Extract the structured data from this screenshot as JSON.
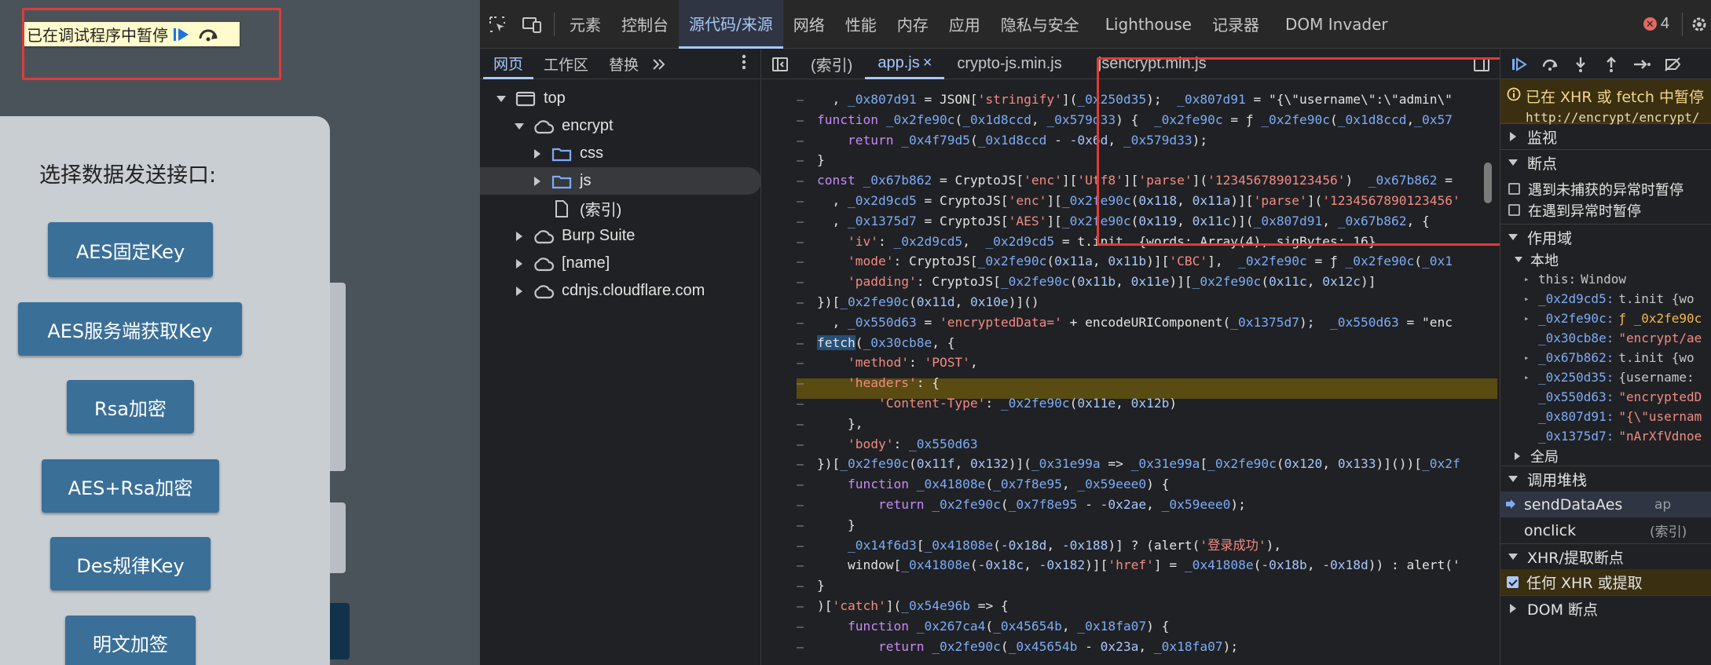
{
  "page": {
    "paused_banner": "已在调试程序中暂停",
    "card_title": "选择数据发送接口:",
    "buttons": [
      "AES固定Key",
      "AES服务端获取Key",
      "Rsa加密",
      "AES+Rsa加密",
      "Des规律Key",
      "明文加签"
    ]
  },
  "devtools": {
    "tabs": [
      "元素",
      "控制台",
      "源代码/来源",
      "网络",
      "性能",
      "内存",
      "应用",
      "隐私与安全",
      "Lighthouse",
      "记录器",
      "DOM Invader"
    ],
    "active_tab": "源代码/来源",
    "error_count": "4",
    "navigator_tabs": [
      "网页",
      "工作区",
      "替换"
    ],
    "tree": [
      {
        "label": "top",
        "icon": "window-icon",
        "arrow": "down"
      },
      {
        "label": "encrypt",
        "icon": "cloud-icon",
        "arrow": "down"
      },
      {
        "label": "css",
        "icon": "folder-icon",
        "arrow": "right"
      },
      {
        "label": "js",
        "icon": "folder-icon",
        "arrow": "right"
      },
      {
        "label": "(索引)",
        "icon": "file-icon",
        "arrow": ""
      },
      {
        "label": "Burp Suite",
        "icon": "cloud-icon",
        "arrow": "right"
      },
      {
        "label": "[name]",
        "icon": "cloud-icon",
        "arrow": "right"
      },
      {
        "label": "cdnjs.cloudflare.com",
        "icon": "cloud-icon",
        "arrow": "right"
      }
    ],
    "editor_tabs": [
      "(索引)",
      "app.js",
      "crypto-js.min.js",
      "jsencrypt.min.js"
    ],
    "active_editor_tab": "app.js",
    "code_lines": [
      "  , _0x807d91 = JSON['stringify'](_0x250d35);  _0x807d91 = \"{\\\"username\\\":\\\"admin\\\"",
      "function _0x2fe90c(_0x1d8ccd, _0x579d33) {  _0x2fe90c = ƒ _0x2fe90c(_0x1d8ccd,_0x57",
      "    return _0x4f79d5(_0x1d8ccd - -0x6d, _0x579d33);",
      "}",
      "const _0x67b862 = CryptoJS['enc']['Utf8']['parse']('1234567890123456')  _0x67b862 =",
      "  , _0x2d9cd5 = CryptoJS['enc'][_0x2fe90c(0x118, 0x11a)]['parse']('1234567890123456'",
      "  , _0x1375d7 = CryptoJS['AES'][_0x2fe90c(0x119, 0x11c)](_0x807d91, _0x67b862, {",
      "    'iv': _0x2d9cd5,  _0x2d9cd5 = t.init  {words: Array(4), sigBytes: 16}",
      "    'mode': CryptoJS[_0x2fe90c(0x11a, 0x11b)]['CBC'],  _0x2fe90c = ƒ _0x2fe90c(_0x1",
      "    'padding': CryptoJS[_0x2fe90c(0x11b, 0x11e)][_0x2fe90c(0x11c, 0x12c)]",
      "})[_0x2fe90c(0x11d, 0x10e)]()",
      "  , _0x550d63 = 'encryptedData=' + encodeURIComponent(_0x1375d7);  _0x550d63 = \"enc",
      "fetch(_0x30cb8e, {",
      "    'method': 'POST',",
      "    'headers': {",
      "        'Content-Type': _0x2fe90c(0x11e, 0x12b)",
      "    },",
      "    'body': _0x550d63",
      "})[_0x2fe90c(0x11f, 0x132)](_0x31e99a => _0x31e99a[_0x2fe90c(0x120, 0x133)]())[_0x2f",
      "    function _0x41808e(_0x7f8e95, _0x59eee0) {",
      "        return _0x2fe90c(_0x7f8e95 - -0x2ae, _0x59eee0);",
      "    }",
      "    _0x14f6d3[_0x41808e(-0x18d, -0x188)] ? (alert('登录成功'),",
      "    window[_0x41808e(-0x18c, -0x182)]['href'] = _0x41808e(-0x18b, -0x18d)) : alert('",
      "}",
      ")['catch'](_0x54e96b => {",
      "    function _0x267ca4(_0x45654b, _0x18fa07) {",
      "        return _0x2fe90c(_0x45654b - 0x23a, _0x18fa07);"
    ],
    "debugger": {
      "paused_title": "已在 XHR 或 fetch 中暂停",
      "paused_url": "http://encrypt/encrypt/",
      "sections": {
        "watch": "监视",
        "breakpoints": "断点",
        "scope": "作用域",
        "local": "本地",
        "global": "全局",
        "call_stack": "调用堆栈",
        "xhr_breakpoints": "XHR/提取断点",
        "dom_breakpoints": "DOM 断点"
      },
      "checkboxes": {
        "uncaught": "遇到未捕获的异常时暂停",
        "caught": "在遇到异常时暂停",
        "any_xhr": "任何 XHR 或提取"
      },
      "scope_vars": [
        {
          "name": "this",
          "value": "Window",
          "kind": "this",
          "arrow": true
        },
        {
          "name": "_0x2d9cd5",
          "value": "t.init  {wo",
          "kind": "obj",
          "arrow": true
        },
        {
          "name": "_0x2fe90c",
          "value": "ƒ _0x2fe90c",
          "kind": "fn",
          "arrow": true
        },
        {
          "name": "_0x30cb8e",
          "value": "\"encrypt/ae",
          "kind": "str",
          "arrow": false
        },
        {
          "name": "_0x67b862",
          "value": "t.init  {wo",
          "kind": "obj",
          "arrow": true
        },
        {
          "name": "_0x250d35",
          "value": "{username:",
          "kind": "obj",
          "arrow": true
        },
        {
          "name": "_0x550d63",
          "value": "\"encryptedD",
          "kind": "str",
          "arrow": false
        },
        {
          "name": "_0x807d91",
          "value": "\"{\\\"usernam",
          "kind": "str",
          "arrow": false
        },
        {
          "name": "_0x1375d7",
          "value": "\"nArXfVdnoe",
          "kind": "str",
          "arrow": false
        }
      ],
      "call_stack": [
        {
          "name": "sendDataAes",
          "loc": "ap"
        },
        {
          "name": "onclick",
          "loc": "(索引)"
        }
      ]
    }
  },
  "colors": {
    "accent": "#a8c7fa",
    "highlight_box": "#e03a3a",
    "button_blue": "#3a6f98",
    "paused_yellow": "#fffbcc"
  }
}
